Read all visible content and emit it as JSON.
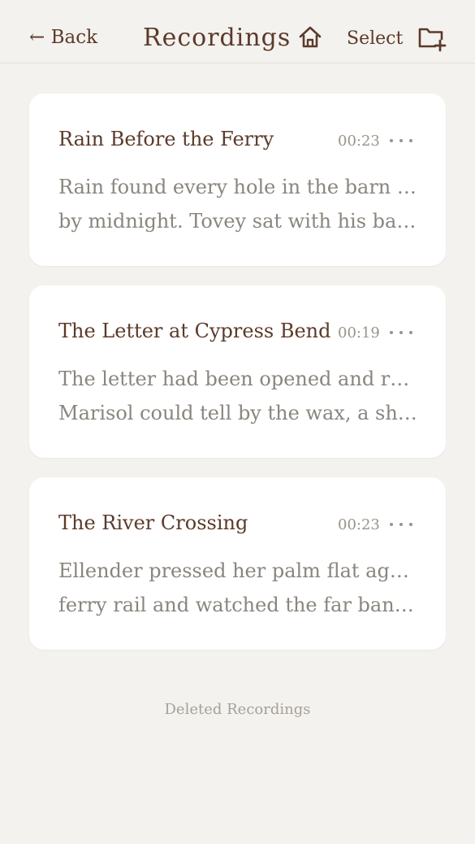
{
  "header": {
    "back_label": "← Back",
    "title": "Recordings",
    "select_label": "Select",
    "home_icon": "home-icon",
    "new_folder_icon": "folder-plus-icon"
  },
  "recordings": [
    {
      "title": "Rain Before the Ferry",
      "duration": "00:23",
      "excerpt_line1": "Rain found every hole in the barn roof",
      "excerpt_line2": "by midnight. Tovey sat with his back a..."
    },
    {
      "title": "The Letter at Cypress Bend",
      "duration": "00:19",
      "excerpt_line1": "The letter had been opened and resealed.",
      "excerpt_line2": "Marisol could tell by the wax, a shade d..."
    },
    {
      "title": "The River Crossing",
      "duration": "00:23",
      "excerpt_line1": "Ellender pressed her palm flat against the",
      "excerpt_line2": "ferry rail and watched the far bank slid..."
    }
  ],
  "footer": {
    "deleted_label": "Deleted Recordings"
  },
  "colors": {
    "background": "#f4f2ee",
    "accent": "#5b3a2a",
    "muted": "#8a857e",
    "card": "#ffffff"
  }
}
